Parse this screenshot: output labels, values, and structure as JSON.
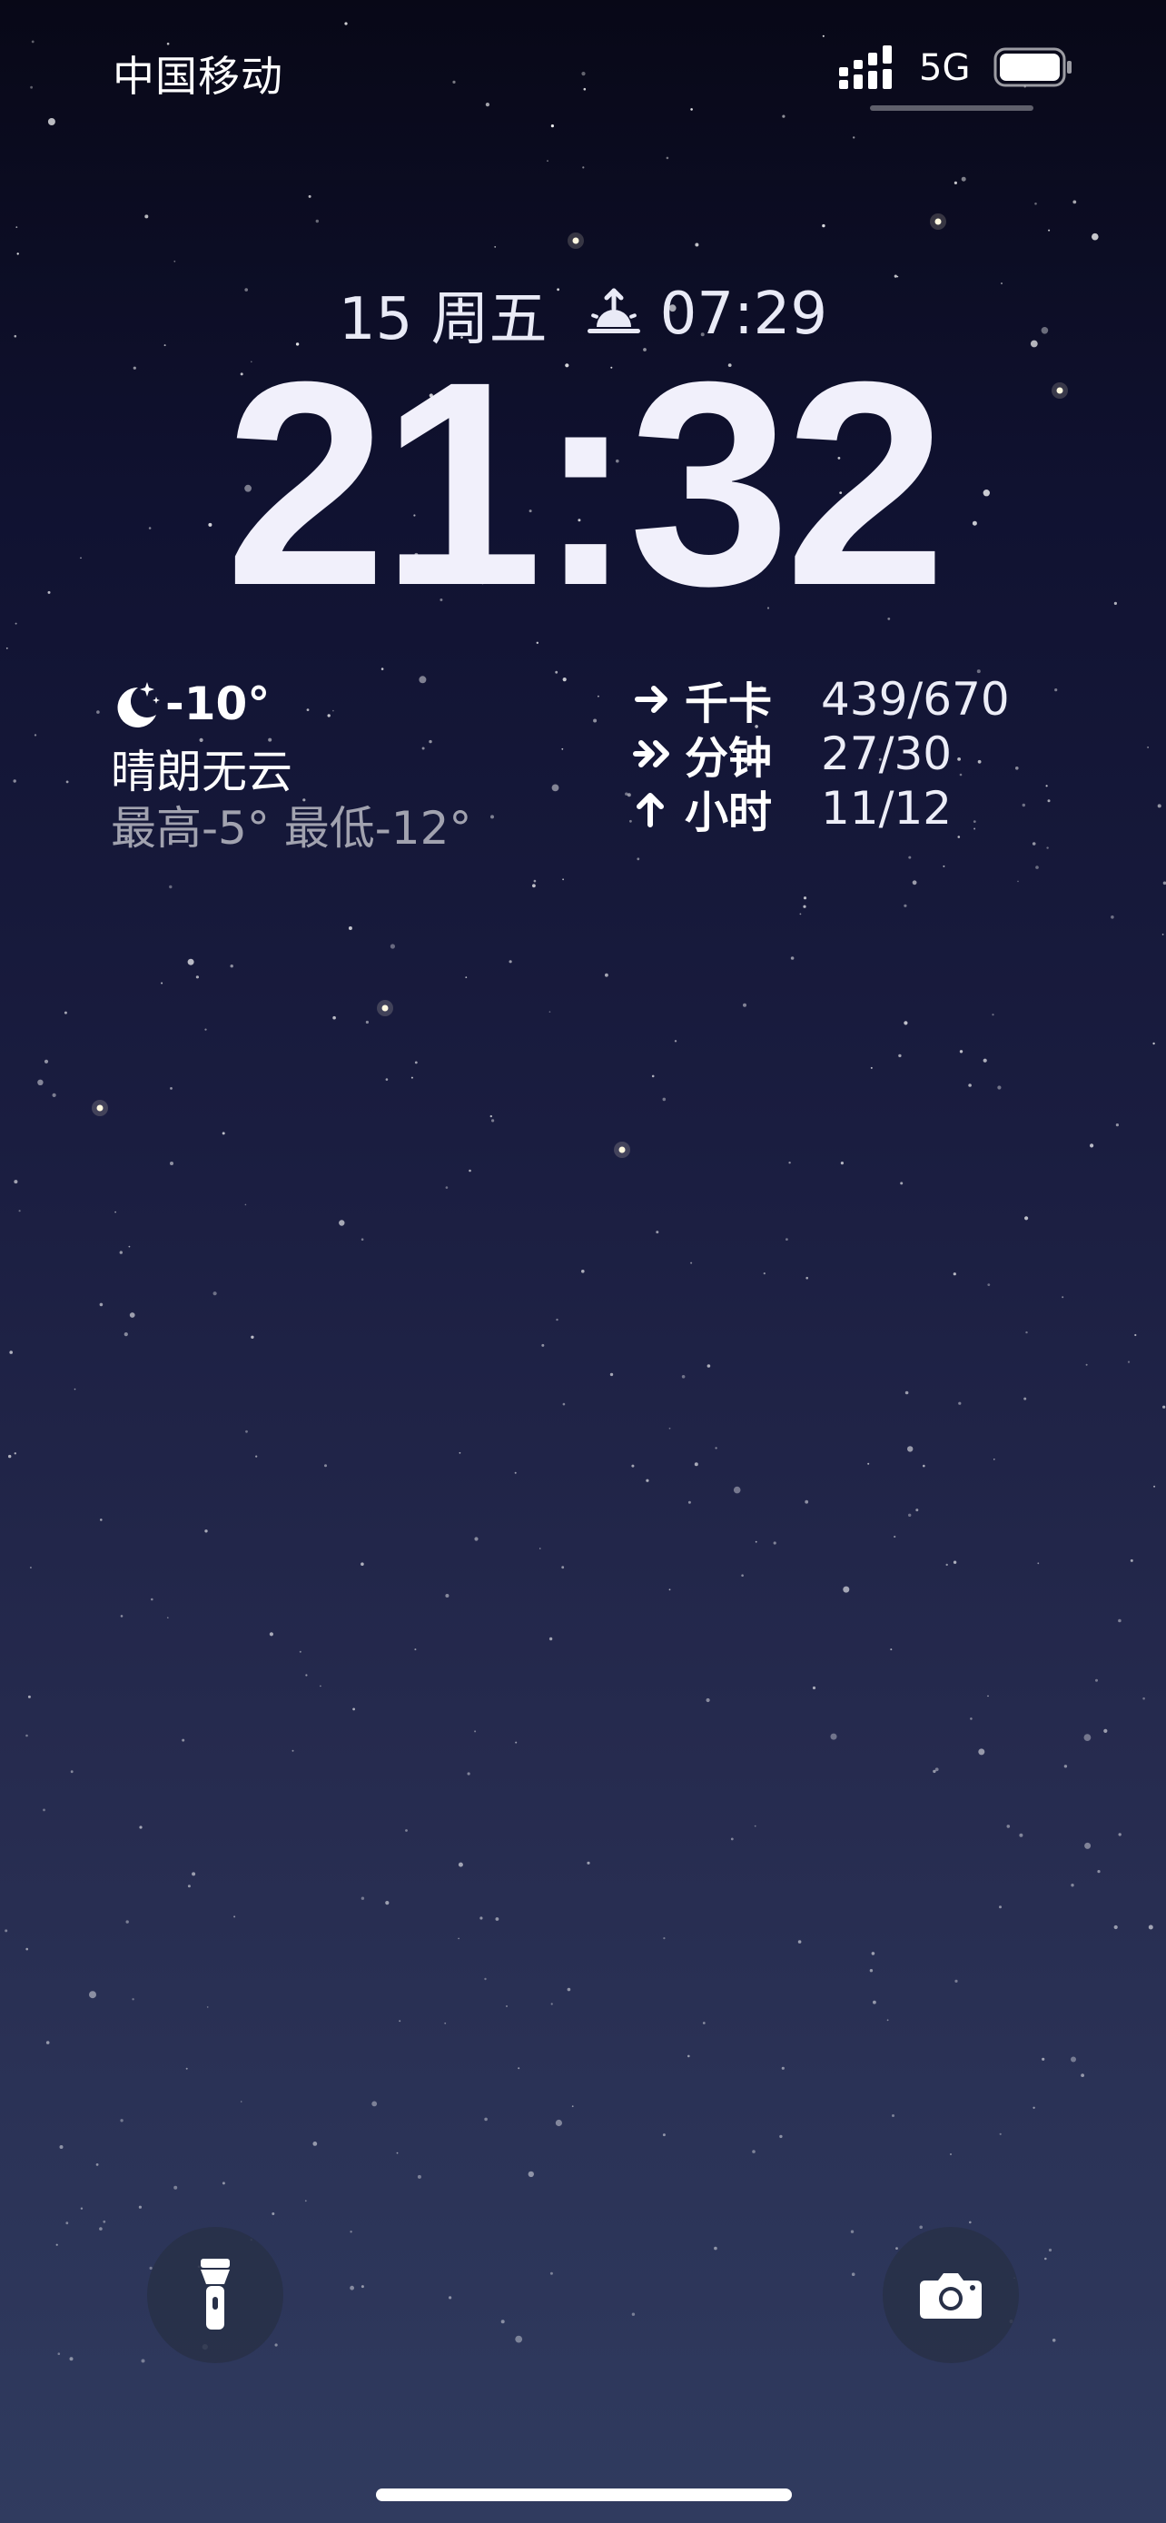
{
  "status_bar": {
    "carrier": "中国移动",
    "network": "5G",
    "signal_icon": "signal-bars-icon",
    "battery_icon": "battery-full-icon"
  },
  "lock_screen": {
    "date": "15 周五",
    "sunrise_icon": "sunrise-icon",
    "sunrise_time": "07:29",
    "time": "21:32"
  },
  "weather": {
    "icon": "moon-stars-icon",
    "temperature": "-10°",
    "condition": "晴朗无云",
    "range": "最高-5° 最低-12°"
  },
  "fitness": {
    "rows": [
      {
        "icon": "arrow-right-icon",
        "label": "千卡",
        "value": "439/670"
      },
      {
        "icon": "double-arrow-right-icon",
        "label": "分钟",
        "value": "27/30"
      },
      {
        "icon": "arrow-up-icon",
        "label": "小时",
        "value": "11/12"
      }
    ]
  },
  "controls": {
    "flashlight_icon": "flashlight-icon",
    "camera_icon": "camera-icon"
  },
  "colors": {
    "background_top": "#080817",
    "background_bottom": "#303b5f",
    "text": "#ffffff",
    "button_bg": "#283048"
  }
}
